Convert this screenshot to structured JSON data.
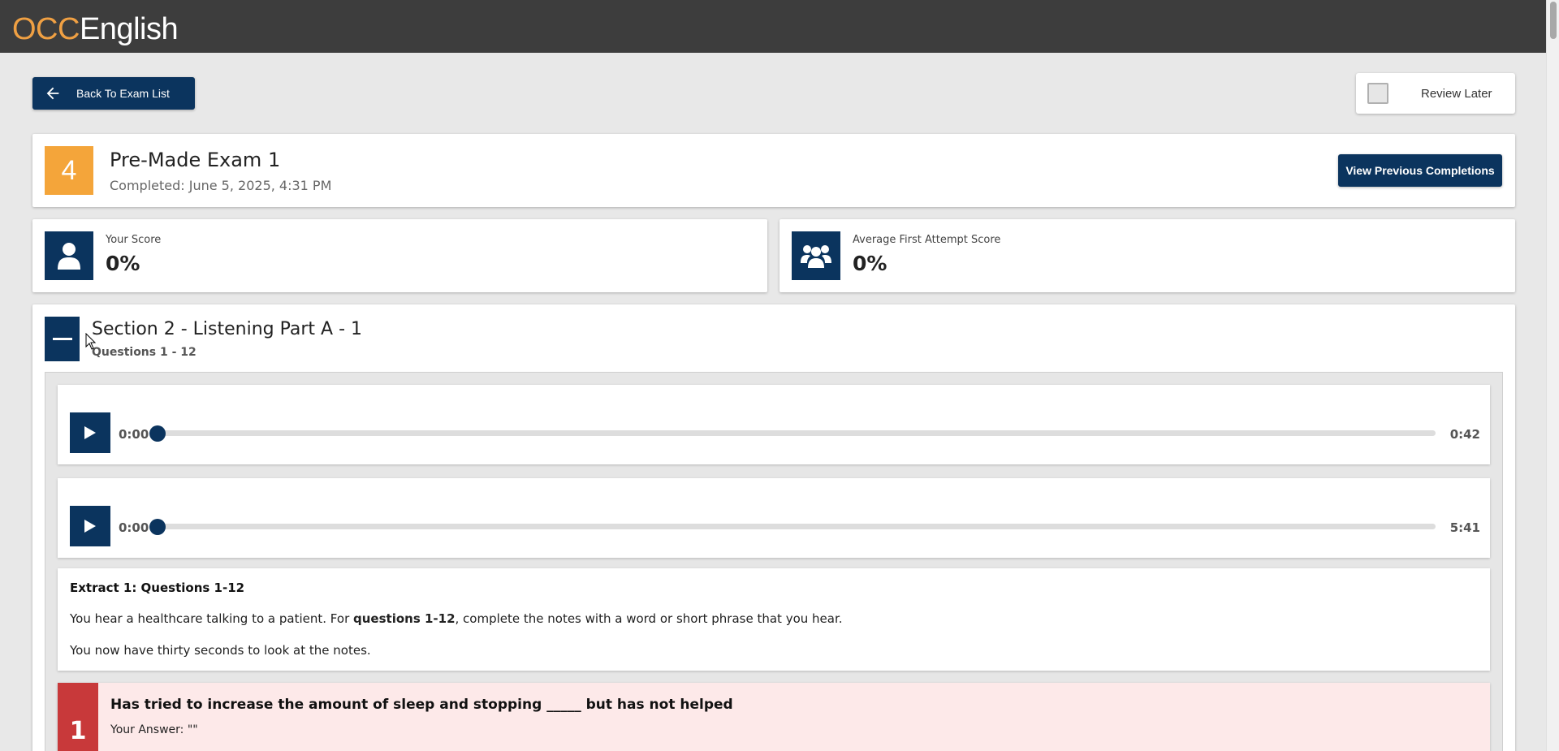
{
  "header": {
    "logo_part1": "OCC",
    "logo_part2": "English"
  },
  "toolbar": {
    "back_label": "Back To Exam List",
    "review_label": "Review Later",
    "review_checked": false
  },
  "exam": {
    "number": "4",
    "title": "Pre-Made Exam 1",
    "completed": "Completed: June 5, 2025, 4:31 PM",
    "view_previous_label": "View Previous Completions"
  },
  "scores": {
    "yours_label": "Your Score",
    "yours_value": "0%",
    "average_label": "Average First Attempt Score",
    "average_value": "0%"
  },
  "section": {
    "title": "Section 2 - Listening Part A - 1",
    "subtitle": "Questions 1 - 12",
    "players": [
      {
        "current": "0:00",
        "total": "0:42",
        "progress": 0
      },
      {
        "current": "0:00",
        "total": "5:41",
        "progress": 0
      }
    ],
    "extract": {
      "title": "Extract 1: Questions 1-12",
      "line1_pre": "You hear a healthcare talking to a patient. For ",
      "line1_bold": "questions 1-12",
      "line1_post": ", complete the notes with a word or short phrase that you hear.",
      "line2": "You now have thirty seconds to look at the notes."
    },
    "questions": [
      {
        "number": "1",
        "text": "Has tried to increase the amount of sleep and stopping _____ but has not helped",
        "answer": "Your Answer: \"\""
      }
    ]
  },
  "colors": {
    "navy": "#0b345e",
    "orange": "#f4a53a",
    "wrong_red": "#c8393a",
    "wrong_bg": "#fde9e9",
    "topbar": "#3d3d3d"
  }
}
